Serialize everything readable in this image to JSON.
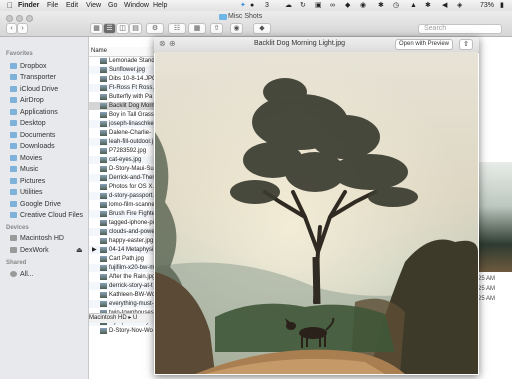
{
  "menubar": {
    "apple_icon": "",
    "items": [
      "Finder",
      "File",
      "Edit",
      "View",
      "Go",
      "Window",
      "Help"
    ],
    "status_number": "3",
    "battery": "73%"
  },
  "finder": {
    "title": "Misc Shots",
    "search_placeholder": "Search",
    "sidebar": {
      "favorites_header": "Favorites",
      "favorites": [
        "Dropbox",
        "Transporter",
        "iCloud Drive",
        "AirDrop",
        "Applications",
        "Desktop",
        "Documents",
        "Downloads",
        "Movies",
        "Music",
        "Pictures",
        "Utilities",
        "Google Drive",
        "Creative Cloud Files"
      ],
      "devices_header": "Devices",
      "devices": [
        "Macintosh HD",
        "DexWork"
      ],
      "shared_header": "Shared",
      "shared": [
        "All..."
      ]
    },
    "list": {
      "column_name": "Name",
      "files": [
        "Lemonade Stand",
        "Sunflower.jpg",
        "Dibs 10-8-14.JPG",
        "Ft-Ross Ft Ross.j",
        "Butterfly with Pa",
        "Backlit Dog Morn",
        "Boy in Tall Grass.",
        "joseph-linaschke",
        "Dalene-Charlie-",
        "leah-fill-outdoor.j",
        "P7283592.jpg",
        "cat-eyes.jpg",
        "D-Story-Maui-Su",
        "Derrick-and-Ther",
        "Photos for OS X.j",
        "d-story-passport.",
        "lomo-film-scanne",
        "Brush Fire Fighter",
        "tagged-iphone-pi",
        "clouds-and-powe",
        "happy-easter.jpg",
        "04-14 Metaphysi",
        "Cart Path.jpg",
        "fujifilm-x20-bw-m",
        "After the Rain.jpg",
        "derrick-story-at-t",
        "Kathleen-BW-Wo",
        "everything-must-",
        "twin-townhouses",
        "olympus-fisheye-",
        "D-Story-Nov-Wo"
      ],
      "path": "Macintosh HD ▸ U"
    },
    "right_dates": [
      "25 AM",
      "25 AM",
      "25 AM"
    ]
  },
  "quicklook": {
    "title": "Backlit Dog Morning Light.jpg",
    "open_button": "Open with Preview",
    "share_icon": "share-icon"
  }
}
